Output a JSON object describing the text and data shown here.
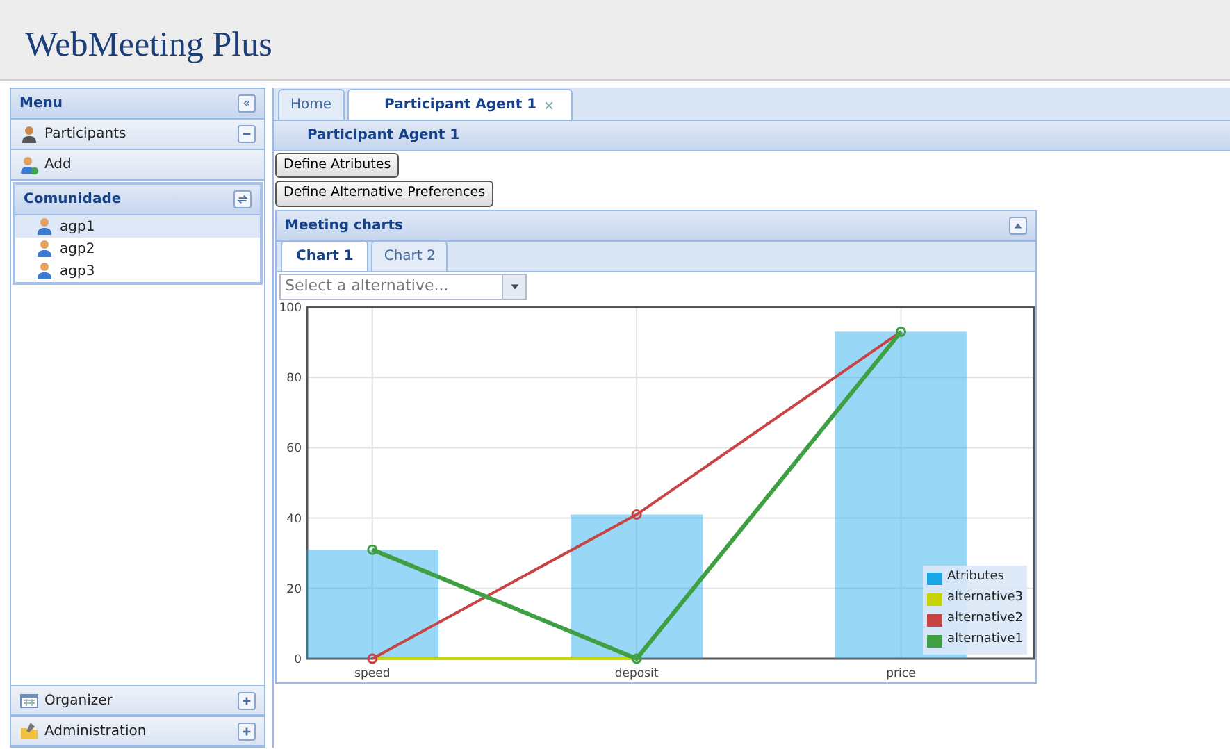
{
  "app_title": "WebMeeting Plus",
  "sidebar": {
    "title": "Menu",
    "collapse_button": "«",
    "sections": [
      {
        "label": "Participants",
        "expanded": true,
        "items": [
          {
            "label": "Add"
          }
        ]
      }
    ],
    "community": {
      "title": "Comunidade",
      "items": [
        {
          "label": "agp1",
          "selected": true
        },
        {
          "label": "agp2",
          "selected": false
        },
        {
          "label": "agp3",
          "selected": false
        }
      ]
    },
    "bottom_sections": [
      {
        "label": "Organizer",
        "expanded": false
      },
      {
        "label": "Administration",
        "expanded": false
      }
    ]
  },
  "tabs": [
    {
      "label": "Home",
      "selected": false,
      "closable": false
    },
    {
      "label": "Participant Agent 1",
      "selected": true,
      "closable": true
    }
  ],
  "panel": {
    "title": "Participant Agent 1",
    "buttons": [
      "Define Atributes",
      "Define Alternative Preferences"
    ]
  },
  "charts_panel": {
    "title": "Meeting charts",
    "expanded": true,
    "tabs": [
      {
        "label": "Chart 1",
        "selected": true
      },
      {
        "label": "Chart 2",
        "selected": false
      }
    ],
    "select": {
      "placeholder": "Select a alternative..."
    },
    "chart_data": {
      "type": "bar",
      "grid": true,
      "legend": true,
      "categories": [
        "speed",
        "deposit",
        "price"
      ],
      "ylim": [
        0,
        100
      ],
      "yticks": [
        0,
        20,
        40,
        60,
        80,
        100
      ],
      "series": [
        {
          "name": "Atributes",
          "color": "#1aa7e8",
          "type": "bar",
          "values": [
            31,
            41,
            93
          ]
        },
        {
          "name": "alternative3",
          "color": "#c8d400",
          "type": "line",
          "marker": false,
          "values": [
            0,
            0,
            null
          ]
        },
        {
          "name": "alternative2",
          "color": "#c84444",
          "type": "line",
          "marker": true,
          "values": [
            0,
            41,
            93
          ]
        },
        {
          "name": "alternative1",
          "color": "#3ea043",
          "type": "line",
          "marker": true,
          "values": [
            31,
            0,
            93
          ]
        }
      ]
    }
  }
}
